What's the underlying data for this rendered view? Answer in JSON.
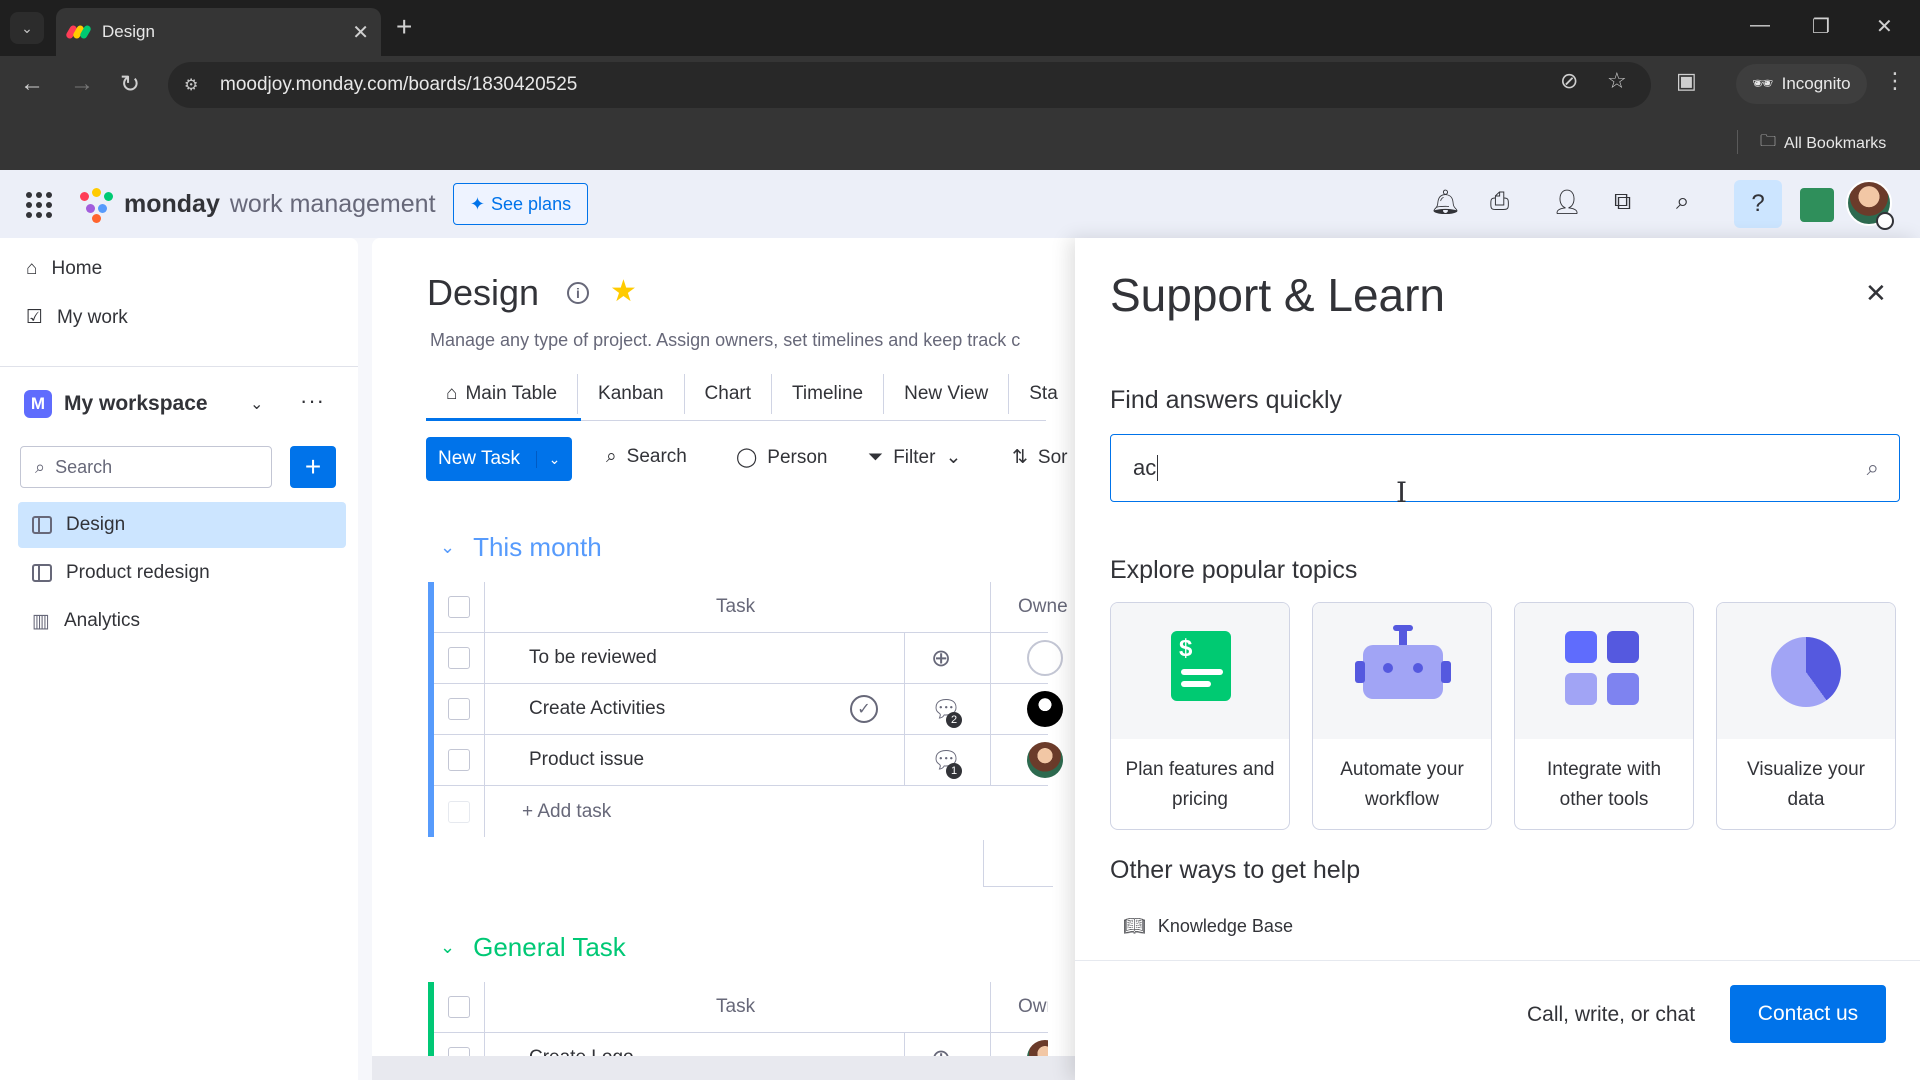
{
  "browser": {
    "tab_title": "Design",
    "url": "moodjoy.monday.com/boards/1830420525",
    "incognito_label": "Incognito",
    "all_bookmarks_label": "All Bookmarks"
  },
  "topbar": {
    "brand_bold": "monday",
    "brand_rest": "work management",
    "see_plans_label": "See plans",
    "icons": [
      "bell-icon",
      "inbox-icon",
      "invite-icon",
      "apps-icon",
      "search-icon",
      "help-icon"
    ],
    "help_active": true
  },
  "sidebar": {
    "home_label": "Home",
    "mywork_label": "My work",
    "workspace_initial": "M",
    "workspace_name": "My workspace",
    "search_placeholder": "Search",
    "items": [
      {
        "label": "Design",
        "icon": "board-icon",
        "active": true
      },
      {
        "label": "Product redesign",
        "icon": "board-icon",
        "active": false
      },
      {
        "label": "Analytics",
        "icon": "dashboard-icon",
        "active": false
      }
    ]
  },
  "board": {
    "title": "Design",
    "description": "Manage any type of project. Assign owners, set timelines and keep track c",
    "views": [
      "Main Table",
      "Kanban",
      "Chart",
      "Timeline",
      "New View",
      "Sta"
    ],
    "new_task_label": "New Task",
    "toolbar": {
      "search": "Search",
      "person": "Person",
      "filter": "Filter",
      "sort": "Sor"
    },
    "groups": [
      {
        "name": "This month",
        "color": "#579bfc",
        "col_task": "Task",
        "col_owner": "Owne",
        "rows": [
          {
            "task": "To be reviewed",
            "updates": 0
          },
          {
            "task": "Create Activities",
            "updates": 2
          },
          {
            "task": "Product issue",
            "updates": 1
          }
        ],
        "add_label": "+ Add task"
      },
      {
        "name": "General Task",
        "color": "#00c875",
        "col_task": "Task",
        "col_owner": "Owne",
        "rows": [
          {
            "task": "Create Logo"
          }
        ]
      }
    ]
  },
  "support": {
    "title": "Support & Learn",
    "find_label": "Find answers quickly",
    "search_value": "ac",
    "explore_label": "Explore popular topics",
    "topics": [
      {
        "label": "Plan features and pricing",
        "icon": "pricing-icon"
      },
      {
        "label": "Automate your workflow",
        "icon": "robot-icon"
      },
      {
        "label": "Integrate with other tools",
        "icon": "integrations-icon"
      },
      {
        "label": "Visualize your data",
        "icon": "pie-chart-icon"
      }
    ],
    "other_label": "Other ways to get help",
    "knowledge_base_label": "Knowledge Base",
    "footer_text": "Call, write, or chat",
    "contact_label": "Contact us"
  }
}
